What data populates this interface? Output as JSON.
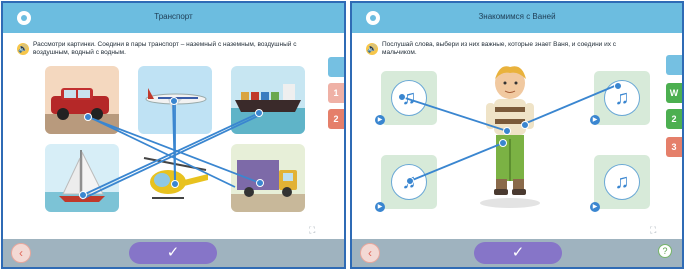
{
  "panel_left": {
    "title": "Транспорт",
    "instruction": "Рассмотри картинки. Соедини в пары транспорт – наземный с наземным, воздушный с воздушным, водный с водным.",
    "tiles": [
      "car-icon",
      "airplane-icon",
      "ship-icon",
      "sailboat-icon",
      "helicopter-icon",
      "truck-icon"
    ],
    "side_tabs": [
      "",
      "1",
      "2"
    ],
    "submit_symbol": "✓",
    "back_symbol": "‹",
    "expand_symbol": "⛶"
  },
  "panel_right": {
    "title": "Знакомимся с Ваней",
    "instruction": "Послушай слова, выбери из них важные, которые знает Ваня, и соедини их с мальчиком.",
    "audio_symbol": "♫",
    "play_symbol": "▶",
    "side_tabs": [
      "",
      "W",
      "2",
      "3"
    ],
    "submit_symbol": "✓",
    "back_symbol": "‹",
    "help_symbol": "?",
    "expand_symbol": "⛶"
  },
  "colors": {
    "titlebar": "#6cbde0",
    "accent": "#3a86d0",
    "submit": "#8675c8",
    "footer": "#9fb3bf"
  }
}
